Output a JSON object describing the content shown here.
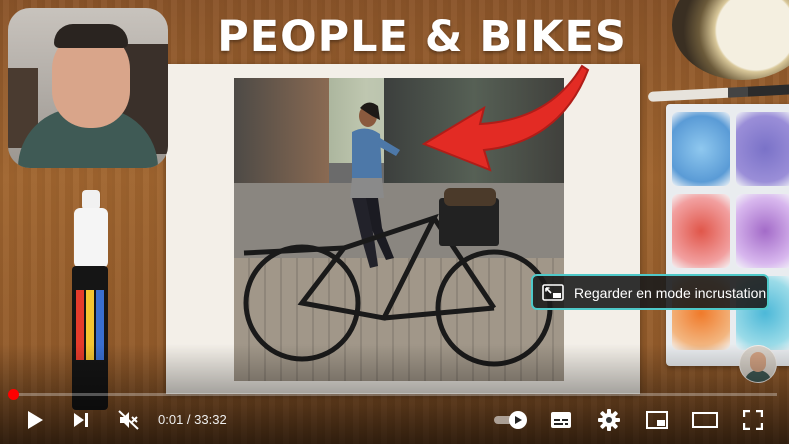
{
  "video": {
    "overlay_title": "PEOPLE & BIKES"
  },
  "pip_tooltip": {
    "label": "Regarder en mode incrustation"
  },
  "player": {
    "current_time": "0:01",
    "separator": " / ",
    "duration": "33:32",
    "progress": 0.0005,
    "autoplay_on": true,
    "muted": true
  },
  "colors": {
    "progress_accent": "#ff0000",
    "tooltip_border": "#4fc9c9"
  },
  "icons": {
    "play": "play-icon",
    "next": "next-icon",
    "mute": "volume-muted-icon",
    "autoplay": "autoplay-toggle-icon",
    "subtitles": "subtitles-icon",
    "settings": "gear-icon",
    "miniplayer": "miniplayer-icon",
    "theater": "theater-mode-icon",
    "fullscreen": "fullscreen-icon"
  }
}
